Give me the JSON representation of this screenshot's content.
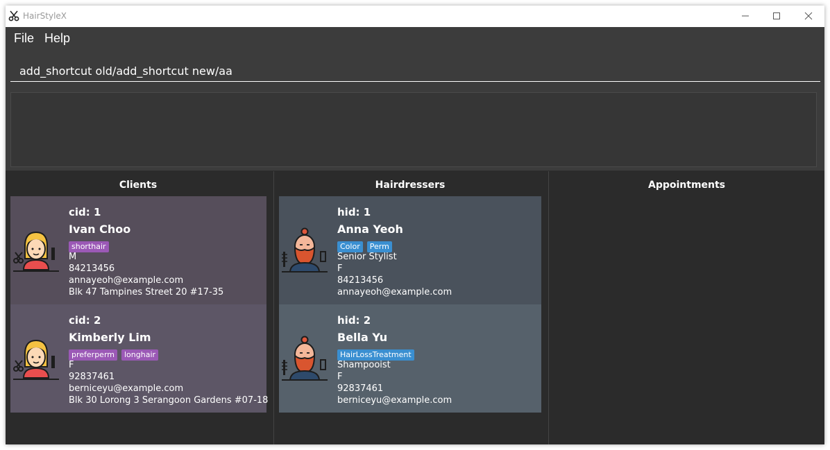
{
  "window": {
    "title": "HairStyleX"
  },
  "menu": {
    "file": "File",
    "help": "Help"
  },
  "command": {
    "value": "add_shortcut old/add_shortcut new/aa"
  },
  "result": {
    "text": ""
  },
  "panels": {
    "clients": "Clients",
    "hairdressers": "Hairdressers",
    "appointments": "Appointments"
  },
  "clients": [
    {
      "id_label": "cid: 1",
      "name": "Ivan Choo",
      "tags": [
        "shorthair"
      ],
      "gender": "M",
      "phone": "84213456",
      "email": "annayeoh@example.com",
      "address": "Blk 47 Tampines Street 20 #17-35"
    },
    {
      "id_label": "cid: 2",
      "name": "Kimberly Lim",
      "tags": [
        "preferperm",
        "longhair"
      ],
      "gender": "F",
      "phone": "92837461",
      "email": "berniceyu@example.com",
      "address": "Blk 30 Lorong 3 Serangoon Gardens #07-18"
    }
  ],
  "hairdressers": [
    {
      "id_label": "hid: 1",
      "name": "Anna Yeoh",
      "tags": [
        "Color",
        "Perm"
      ],
      "title": "Senior Stylist",
      "gender": "F",
      "phone": "84213456",
      "email": "annayeoh@example.com"
    },
    {
      "id_label": "hid: 2",
      "name": "Bella Yu",
      "tags": [
        "HairLossTreatment"
      ],
      "title": "Shampooist",
      "gender": "F",
      "phone": "92837461",
      "email": "berniceyu@example.com"
    }
  ],
  "colors": {
    "window_bg": "#2b2b2b",
    "client_card_1": "#564e5b",
    "client_card_2": "#5d5666",
    "hairdresser_card_1": "#4a525c",
    "hairdresser_card_2": "#56616b",
    "client_tag": "#9b59b6",
    "hairdresser_tag": "#3a8fd1"
  },
  "icons": {
    "app": "scissors-icon",
    "client_avatar": "client-avatar-icon",
    "hairdresser_avatar": "hairdresser-avatar-icon"
  }
}
